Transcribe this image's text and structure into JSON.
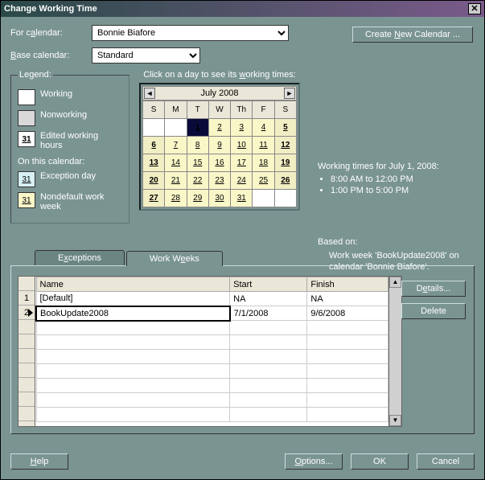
{
  "title": "Change Working Time",
  "for_calendar_label": "For calendar:",
  "for_calendar_value": "Bonnie Biafore",
  "create_new_btn": "Create New Calendar ...",
  "base_calendar_label": "Base calendar:",
  "base_calendar_value": "Standard",
  "legend": {
    "title": "Legend:",
    "working": "Working",
    "nonworking": "Nonworking",
    "edited": "Edited working hours",
    "on_this": "On this calendar:",
    "exception": "Exception day",
    "nondefault": "Nondefault work week",
    "num": "31"
  },
  "cal": {
    "instruction": "Click on a day to see its working times:",
    "month": "July 2008",
    "dow": [
      "S",
      "M",
      "T",
      "W",
      "Th",
      "F",
      "S"
    ],
    "weeks": [
      [
        "",
        "",
        "1",
        "2",
        "3",
        "4",
        "5"
      ],
      [
        "6",
        "7",
        "8",
        "9",
        "10",
        "11",
        "12"
      ],
      [
        "13",
        "14",
        "15",
        "16",
        "17",
        "18",
        "19"
      ],
      [
        "20",
        "21",
        "22",
        "23",
        "24",
        "25",
        "26"
      ],
      [
        "27",
        "28",
        "29",
        "30",
        "31",
        "",
        ""
      ]
    ],
    "selected": "1"
  },
  "info": {
    "heading": "Working times for July 1, 2008:",
    "t1": "8:00 AM to 12:00 PM",
    "t2": "1:00 PM to 5:00 PM",
    "based_on_label": "Based on:",
    "based_on_text": "Work week 'BookUpdate2008' on calendar 'Bonnie Biafore'."
  },
  "tabs": {
    "exceptions": "Exceptions",
    "workweeks": "Work Weeks"
  },
  "grid": {
    "cols": {
      "name": "Name",
      "start": "Start",
      "finish": "Finish"
    },
    "rows": [
      {
        "n": "1",
        "name": "[Default]",
        "start": "NA",
        "finish": "NA"
      },
      {
        "n": "2",
        "name": "BookUpdate2008",
        "start": "7/1/2008",
        "finish": "9/6/2008"
      }
    ]
  },
  "btns": {
    "details": "Details...",
    "delete": "Delete",
    "help": "Help",
    "options": "Options...",
    "ok": "OK",
    "cancel": "Cancel"
  }
}
